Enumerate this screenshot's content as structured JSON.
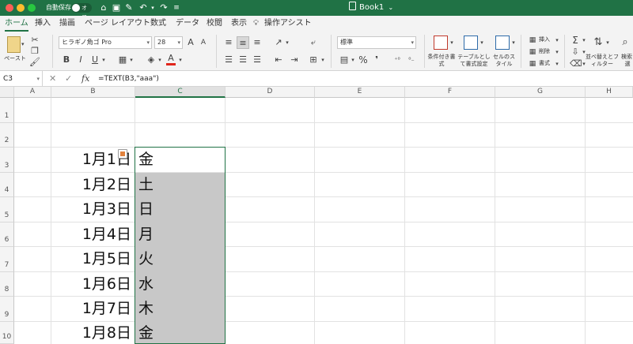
{
  "titlebar": {
    "autosave_label": "自動保存",
    "autosave_state": "オフ",
    "doc_title": "Book1",
    "doc_title_chevron": "⌄"
  },
  "menu": {
    "tabs": [
      {
        "label": "ホーム",
        "active": true
      },
      {
        "label": "挿入",
        "active": false
      },
      {
        "label": "描画",
        "active": false
      },
      {
        "label": "ページ レイアウト",
        "active": false
      },
      {
        "label": "数式",
        "active": false
      },
      {
        "label": "データ",
        "active": false
      },
      {
        "label": "校閲",
        "active": false
      },
      {
        "label": "表示",
        "active": false
      }
    ],
    "tellme_label": "操作アシスト"
  },
  "ribbon": {
    "paste_label": "ペースト",
    "font_name": "ヒラギノ角ゴ Pro",
    "font_size": "28",
    "grow_font": "A",
    "shrink_font": "A",
    "bold": "B",
    "italic": "I",
    "underline": "U",
    "font_color_glyph": "A",
    "number_format": "標準",
    "percent": "%",
    "comma": "❜",
    "cond_format_label": "条件付き書式",
    "table_format_label": "テーブルとして書式設定",
    "cell_styles_label": "セルのスタイル",
    "insert_label": "挿入",
    "delete_label": "削除",
    "format_label": "書式",
    "sort_filter_label": "並べ替えとフィルター",
    "find_label": "検索",
    "find_label_2": "選",
    "sigma": "Σ"
  },
  "formula_bar": {
    "name_box": "C3",
    "fx": "fx",
    "formula": "=TEXT(B3,\"aaa\")"
  },
  "sheet": {
    "columns": [
      "A",
      "B",
      "C",
      "D",
      "E",
      "F",
      "G",
      "H"
    ],
    "selected_column": "C",
    "rows": [
      "1",
      "2",
      "3",
      "4",
      "5",
      "6",
      "7",
      "8",
      "9",
      "10"
    ],
    "data_rows": [
      {
        "b": "1月1日",
        "c": "金"
      },
      {
        "b": "1月2日",
        "c": "土"
      },
      {
        "b": "1月3日",
        "c": "日"
      },
      {
        "b": "1月4日",
        "c": "月"
      },
      {
        "b": "1月5日",
        "c": "火"
      },
      {
        "b": "1月6日",
        "c": "水"
      },
      {
        "b": "1月7日",
        "c": "木"
      },
      {
        "b": "1月8日",
        "c": "金"
      }
    ]
  },
  "colors": {
    "excel_green": "#207245",
    "selection_fill": "#c8c8c8"
  }
}
